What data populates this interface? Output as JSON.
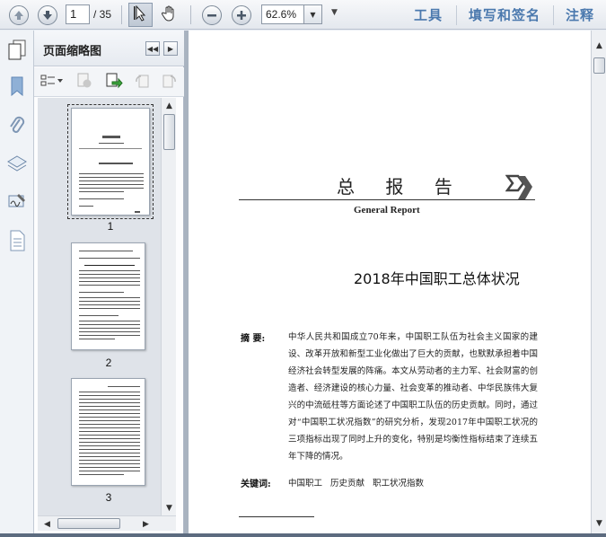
{
  "toolbar": {
    "page_current": "1",
    "page_total": "/ 35",
    "zoom_value": "62.6%",
    "links": {
      "tools": "工具",
      "fill_sign": "填写和签名",
      "comment": "注释"
    },
    "icons": [
      "arrow-up-icon",
      "arrow-down-icon",
      "select-cursor-icon",
      "hand-icon",
      "zoom-out-icon",
      "zoom-in-icon"
    ]
  },
  "thumb_panel": {
    "title": "页面缩略图",
    "pages": [
      {
        "label": "1",
        "selected": true
      },
      {
        "label": "2",
        "selected": false
      },
      {
        "label": "3",
        "selected": false
      }
    ]
  },
  "document": {
    "section_title": "总 报 告",
    "section_subtitle": "General Report",
    "heading": "2018年中国职工总体状况",
    "abstract_label": "摘 要:",
    "abstract_text": "中华人民共和国成立70年来，中国职工队伍为社会主义国家的建设、改革开放和新型工业化做出了巨大的贡献，也默默承担着中国经济社会转型发展的阵痛。本文从劳动者的主力军、社会财富的创造者、经济建设的核心力量、社会变革的推动者、中华民族伟大复兴的中流砥柱等方面论述了中国职工队伍的历史贡献。同时，通过对“中国职工状况指数”的研究分析，发现2017年中国职工状况的三项指标出现了同时上升的变化，特别是均衡性指标结束了连续五年下降的情况。",
    "keywords_label": "关键词:",
    "keywords": "中国职工 历史贡献 职工状况指数"
  },
  "colors": {
    "link_blue": "#4b79ae",
    "rail_icon_blue": "#6f95bf"
  }
}
